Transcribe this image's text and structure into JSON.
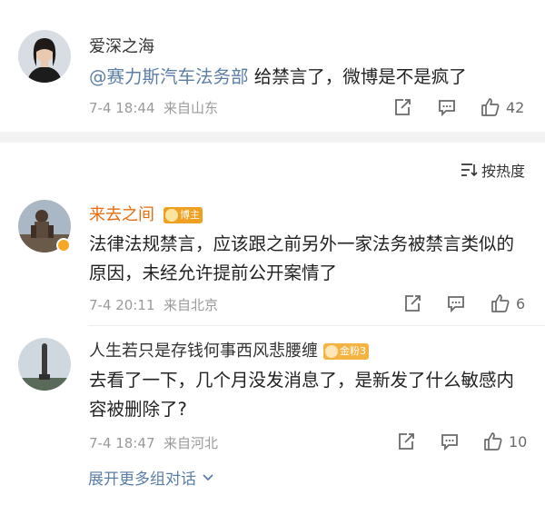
{
  "top_comment": {
    "username": "爱深之海",
    "mention": "@赛力斯汽车法务部",
    "text": " 给禁言了，微博是不是疯了",
    "time": "7-4 18:44",
    "location": "来自山东",
    "likes": "42"
  },
  "sort": {
    "label": "按热度"
  },
  "comments": [
    {
      "username": "来去之间",
      "badge": "博主",
      "text": "法律法规禁言，应该跟之前另外一家法务被禁言类似的原因，未经允许提前公开案情了",
      "time": "7-4 20:11",
      "location": "来自北京",
      "likes": "6"
    },
    {
      "username": "人生若只是存钱何事西风悲腰缠",
      "badge": "金粉3",
      "text": "去看了一下，几个月没发消息了，是新发了什么敏感内容被删除了?",
      "time": "7-4 18:47",
      "location": "来自河北",
      "likes": "10"
    }
  ],
  "more_replies": {
    "label": "展开更多组对话"
  },
  "colors": {
    "accent_link": "#5b7ea6",
    "blogger_name": "#e86b0c",
    "blogger_badge": "#f0a020",
    "fan_badge": "#f5b342"
  }
}
